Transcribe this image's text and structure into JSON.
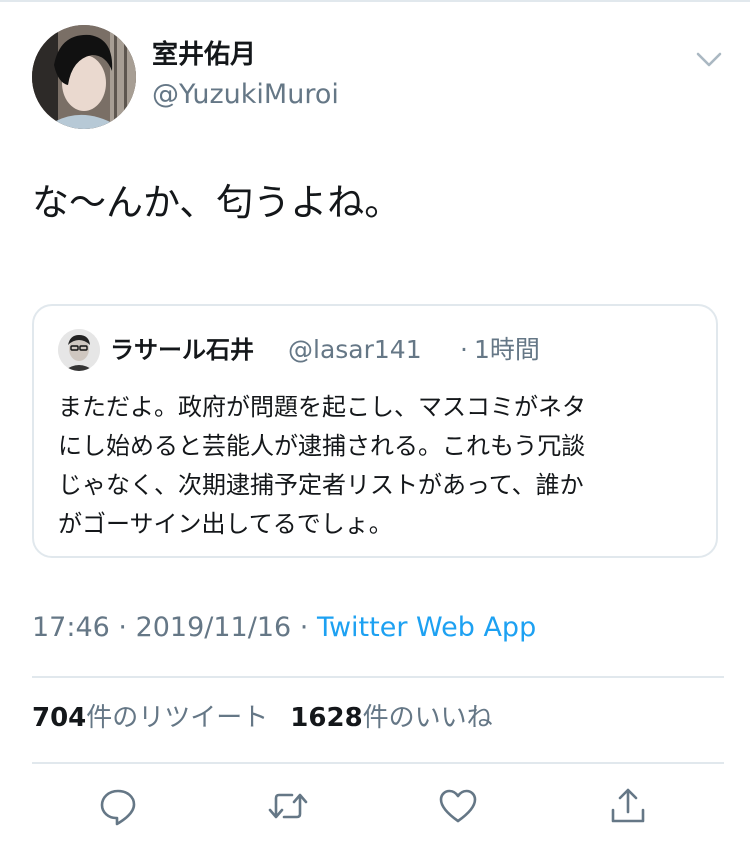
{
  "tweet": {
    "author": {
      "display_name": "室井佑月",
      "handle": "@YuzukiMuroi"
    },
    "text": "な〜んか、匂うよね。",
    "quoted": {
      "author": {
        "display_name": "ラサール石井",
        "handle": "@lasar141"
      },
      "separator": "·",
      "time": "1時間",
      "lines": [
        "まただよ。政府が問題を起こし、マスコミがネタ",
        "にし始めると芸能人が逮捕される。これもう冗談",
        "じゃなく、次期逮捕予定者リストがあって、誰か",
        "がゴーサイン出してるでしょ。"
      ]
    },
    "meta": {
      "time": "17:46",
      "sep1": " · ",
      "date": "2019/11/16",
      "sep2": " · ",
      "app": "Twitter Web App"
    },
    "stats": {
      "retweets": "704",
      "retweets_label": "件のリツイート",
      "likes": "1628",
      "likes_label": "件のいいね"
    }
  },
  "icons": {
    "menu": "chevron-down-icon",
    "reply": "reply-icon",
    "retweet": "retweet-icon",
    "like": "heart-icon",
    "share": "share-icon"
  },
  "colors": {
    "text": "#14171a",
    "secondary": "#657786",
    "link": "#1da1f2",
    "border": "#e1e8ed"
  }
}
